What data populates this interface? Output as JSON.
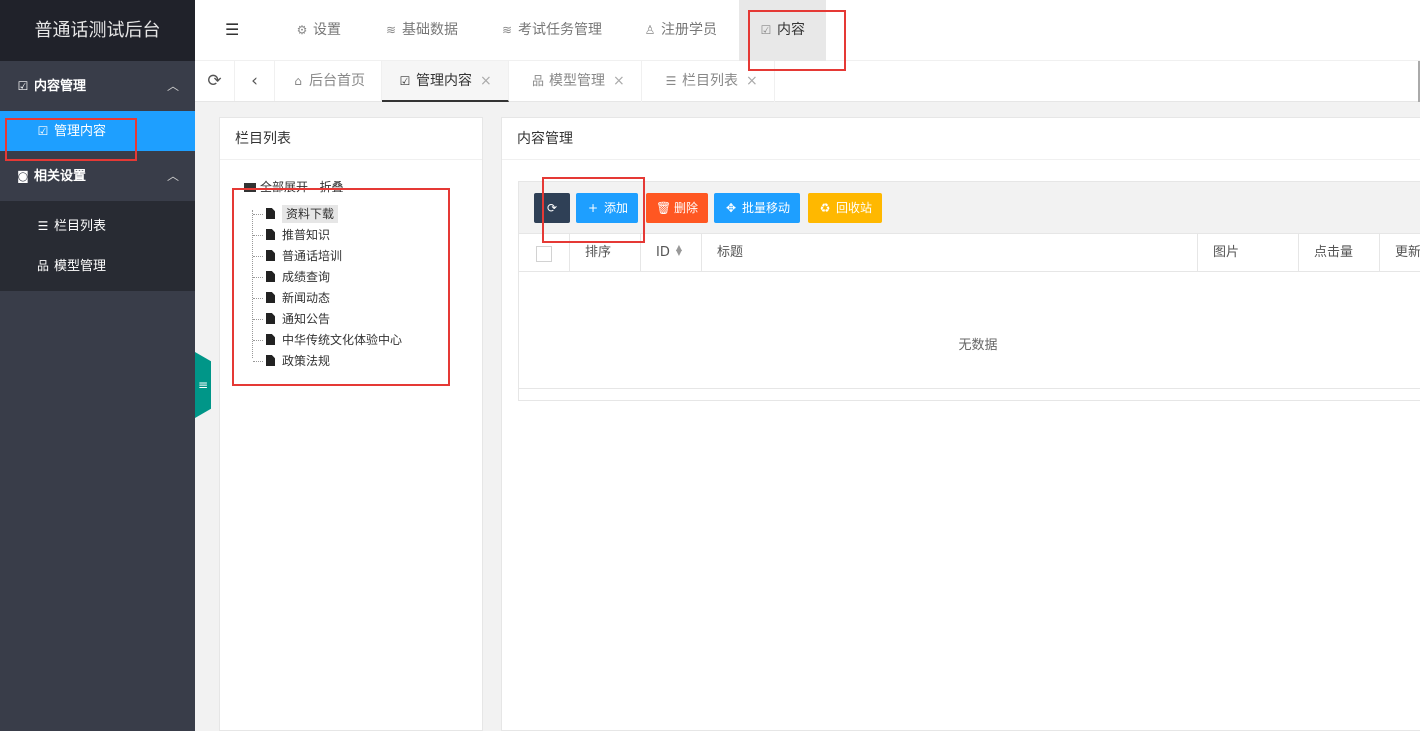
{
  "app": {
    "title": "普通话测试后台"
  },
  "sidebar": {
    "groups": [
      {
        "label": "内容管理",
        "icon": "edit-icon",
        "chevron": "︿",
        "items": [
          {
            "label": "管理内容",
            "icon": "edit-icon",
            "active": true
          }
        ]
      },
      {
        "label": "相关设置",
        "icon": "settings-doc-icon",
        "chevron": "︿",
        "items": [
          {
            "label": "栏目列表",
            "icon": "list-icon"
          },
          {
            "label": "模型管理",
            "icon": "sitemap-icon"
          }
        ]
      }
    ]
  },
  "topnav": {
    "items": [
      {
        "label": "设置",
        "icon": "gear-icon"
      },
      {
        "label": "基础数据",
        "icon": "database-icon"
      },
      {
        "label": "考试任务管理",
        "icon": "database-icon"
      },
      {
        "label": "注册学员",
        "icon": "user-icon"
      },
      {
        "label": "内容",
        "icon": "edit-icon",
        "active": true
      }
    ]
  },
  "tabs": {
    "items": [
      {
        "label": "后台首页",
        "icon": "home-icon",
        "closable": false
      },
      {
        "label": "管理内容",
        "icon": "edit-icon",
        "closable": true,
        "active": true
      },
      {
        "label": "模型管理",
        "icon": "sitemap-icon",
        "closable": true
      },
      {
        "label": "栏目列表",
        "icon": "list-icon",
        "closable": true
      }
    ],
    "close_glyph": "×"
  },
  "left_panel": {
    "title": "栏目列表",
    "tree_header": "全部展开   折叠",
    "nodes": [
      "资料下载",
      "推普知识",
      "普通话培训",
      "成绩查询",
      "新闻动态",
      "通知公告",
      "中华传统文化体验中心",
      "政策法规"
    ]
  },
  "right_panel": {
    "title": "内容管理",
    "buttons": [
      {
        "label": "",
        "icon": "refresh-icon",
        "color": "#2f4056"
      },
      {
        "label": "添加",
        "icon": "plus-icon",
        "color": "#1e9fff"
      },
      {
        "label": "删除",
        "icon": "trash-icon",
        "color": "#ff5722"
      },
      {
        "label": "批量移动",
        "icon": "move-icon",
        "color": "#1e9fff"
      },
      {
        "label": "回收站",
        "icon": "recycle-icon",
        "color": "#ffb800"
      }
    ],
    "columns": [
      "排序",
      "ID",
      "标题",
      "图片",
      "点击量",
      "更新"
    ],
    "empty_text": "无数据"
  },
  "colors": {
    "sidebar": "#393d49",
    "logo_bg": "#20222a",
    "active": "#1e9fff",
    "highlight": "#e53935"
  }
}
